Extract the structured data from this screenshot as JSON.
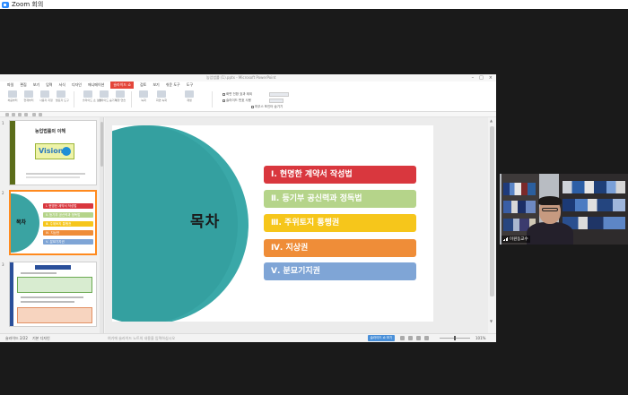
{
  "zoom": {
    "title": "Zoom 회의"
  },
  "app": {
    "doc_title": "농업법률 (1).pptx - Microsoft PowerPoint",
    "window_controls": [
      "–",
      "□",
      "×"
    ],
    "menus": [
      "파일",
      "편집",
      "보기",
      "입력",
      "서식",
      "디자인",
      "애니메이션",
      "슬라이드 쇼",
      "검토",
      "보기",
      "쉬운 도구",
      "도구"
    ],
    "active_menu_label": "슬라이드 쇼",
    "ribbon": {
      "groups": [
        "처음부터",
        "현재부터",
        "사용자 지정",
        "발표자 도구",
        "슬라이드 쇼 설정",
        "슬라이드 숨기기",
        "예행 연습",
        "녹화",
        "화면 녹화",
        "재생",
        "슬라이드 쇼 모니터"
      ],
      "check1": "화면 전환 효과 제외",
      "check2": "슬라이드 번호 사용",
      "check3": "마우스 포인터 숨기기"
    }
  },
  "thumbnails": {
    "nums": [
      "1",
      "2",
      "3"
    ],
    "t1_title": "농업법률의 이해",
    "t1_vision": "Vision",
    "t2_mok": "목차",
    "t2_items": [
      "Ⅰ. 현명한 계약서 작성법",
      "Ⅱ. 등기부 공신력과 정독법",
      "Ⅲ. 주위토지 통행권",
      "Ⅳ. 지상권",
      "Ⅴ. 분묘기지권"
    ],
    "t3_header": "Ⅰ. 현명한 계약서 작성법"
  },
  "slide": {
    "heading": "목차",
    "items": [
      {
        "label": "Ⅰ. 현명한 계약서 작성법",
        "color": "#d9373e"
      },
      {
        "label": "Ⅱ. 등기부 공신력과 정독법",
        "color": "#b5d48a"
      },
      {
        "label": "Ⅲ. 주위토지 통행권",
        "color": "#f6c61b"
      },
      {
        "label": "Ⅳ. 지상권",
        "color": "#ef8d38"
      },
      {
        "label": "Ⅴ. 분묘기지권",
        "color": "#7fa5d6"
      }
    ],
    "accent": "#3aa8a8"
  },
  "status": {
    "slide_pos": "슬라이드 2/22",
    "theme": "기본 디자인",
    "note": "여기에 슬라이드 노트의 내용을 입력하십시오",
    "show_button": "슬라이드 쇼 보기",
    "zoom": "101%"
  },
  "video": {
    "name": "이원동교수"
  }
}
